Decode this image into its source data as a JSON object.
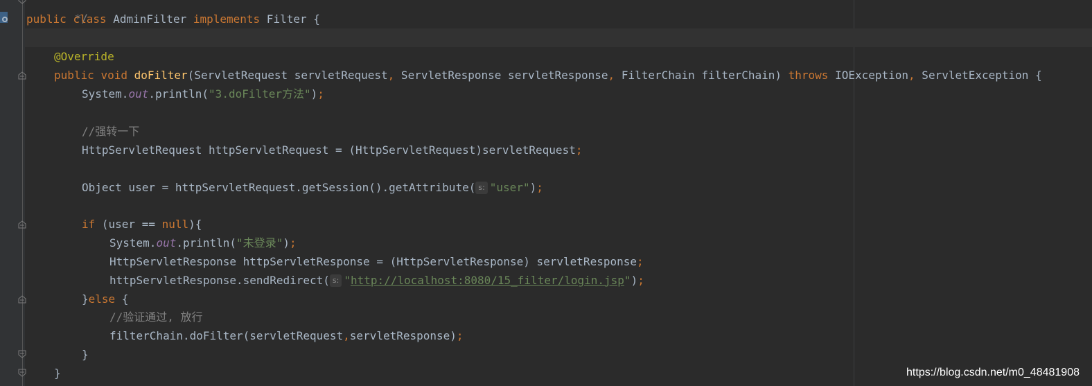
{
  "editor": {
    "colors": {
      "background": "#2b2b2b",
      "gutter": "#313335",
      "keyword": "#cc7832",
      "annotation": "#bbb529",
      "method": "#ffc66d",
      "string": "#6a8759",
      "field": "#9876aa",
      "comment": "#808080",
      "plain": "#a9b7c6"
    },
    "gutter_icons": [
      "implementation-marker-icon"
    ],
    "lines": {
      "l0": {
        "a": "*/"
      },
      "l1": {
        "a": "public",
        "b": " ",
        "c": "class",
        "d": " AdminFilter ",
        "e": "implements",
        "f": " Filter {"
      },
      "l3": {
        "a": "@Override"
      },
      "l4": {
        "a": "public",
        "b": " ",
        "c": "void",
        "d": " ",
        "e": "doFilter",
        "f": "(ServletRequest servletRequest",
        "g": ",",
        "h": " ServletResponse servletResponse",
        "i": ",",
        "j": " FilterChain filterChain) ",
        "k": "throws",
        "l": " IOException",
        "m": ",",
        "n": " ServletException {"
      },
      "l5": {
        "a": "System.",
        "b": "out",
        "c": ".println(",
        "d": "\"3.doFilter方法\"",
        "e": ")",
        "f": ";"
      },
      "l7": {
        "a": "//强转一下"
      },
      "l8": {
        "a": "HttpServletRequest httpServletRequest = (HttpServletRequest)servletRequest",
        "b": ";"
      },
      "l10": {
        "a": "Object user = httpServletRequest.getSession().getAttribute(",
        "hint": "s:",
        "b": "\"user\"",
        "c": ")",
        "d": ";"
      },
      "l12": {
        "a": "if",
        "b": " (user == ",
        "c": "null",
        "d": "){"
      },
      "l13": {
        "a": "System.",
        "b": "out",
        "c": ".println(",
        "d": "\"未登录\"",
        "e": ")",
        "f": ";"
      },
      "l14": {
        "a": "HttpServletResponse httpServletResponse = (HttpServletResponse) servletResponse",
        "b": ";"
      },
      "l15": {
        "a": "httpServletResponse.sendRedirect(",
        "hint": "s:",
        "b": "\"",
        "c": "http://localhost:8080/15_filter/login.jsp",
        "d": "\"",
        "e": ")",
        "f": ";"
      },
      "l16": {
        "a": "}",
        "b": "else",
        "c": " {"
      },
      "l17": {
        "a": "//验证通过, 放行"
      },
      "l18": {
        "a": "filterChain.doFilter(servletRequest",
        "b": ",",
        "c": "servletResponse)",
        "d": ";"
      },
      "l19": {
        "a": "}"
      },
      "l20": {
        "a": "}"
      }
    }
  },
  "watermark": "https://blog.csdn.net/m0_48481908"
}
